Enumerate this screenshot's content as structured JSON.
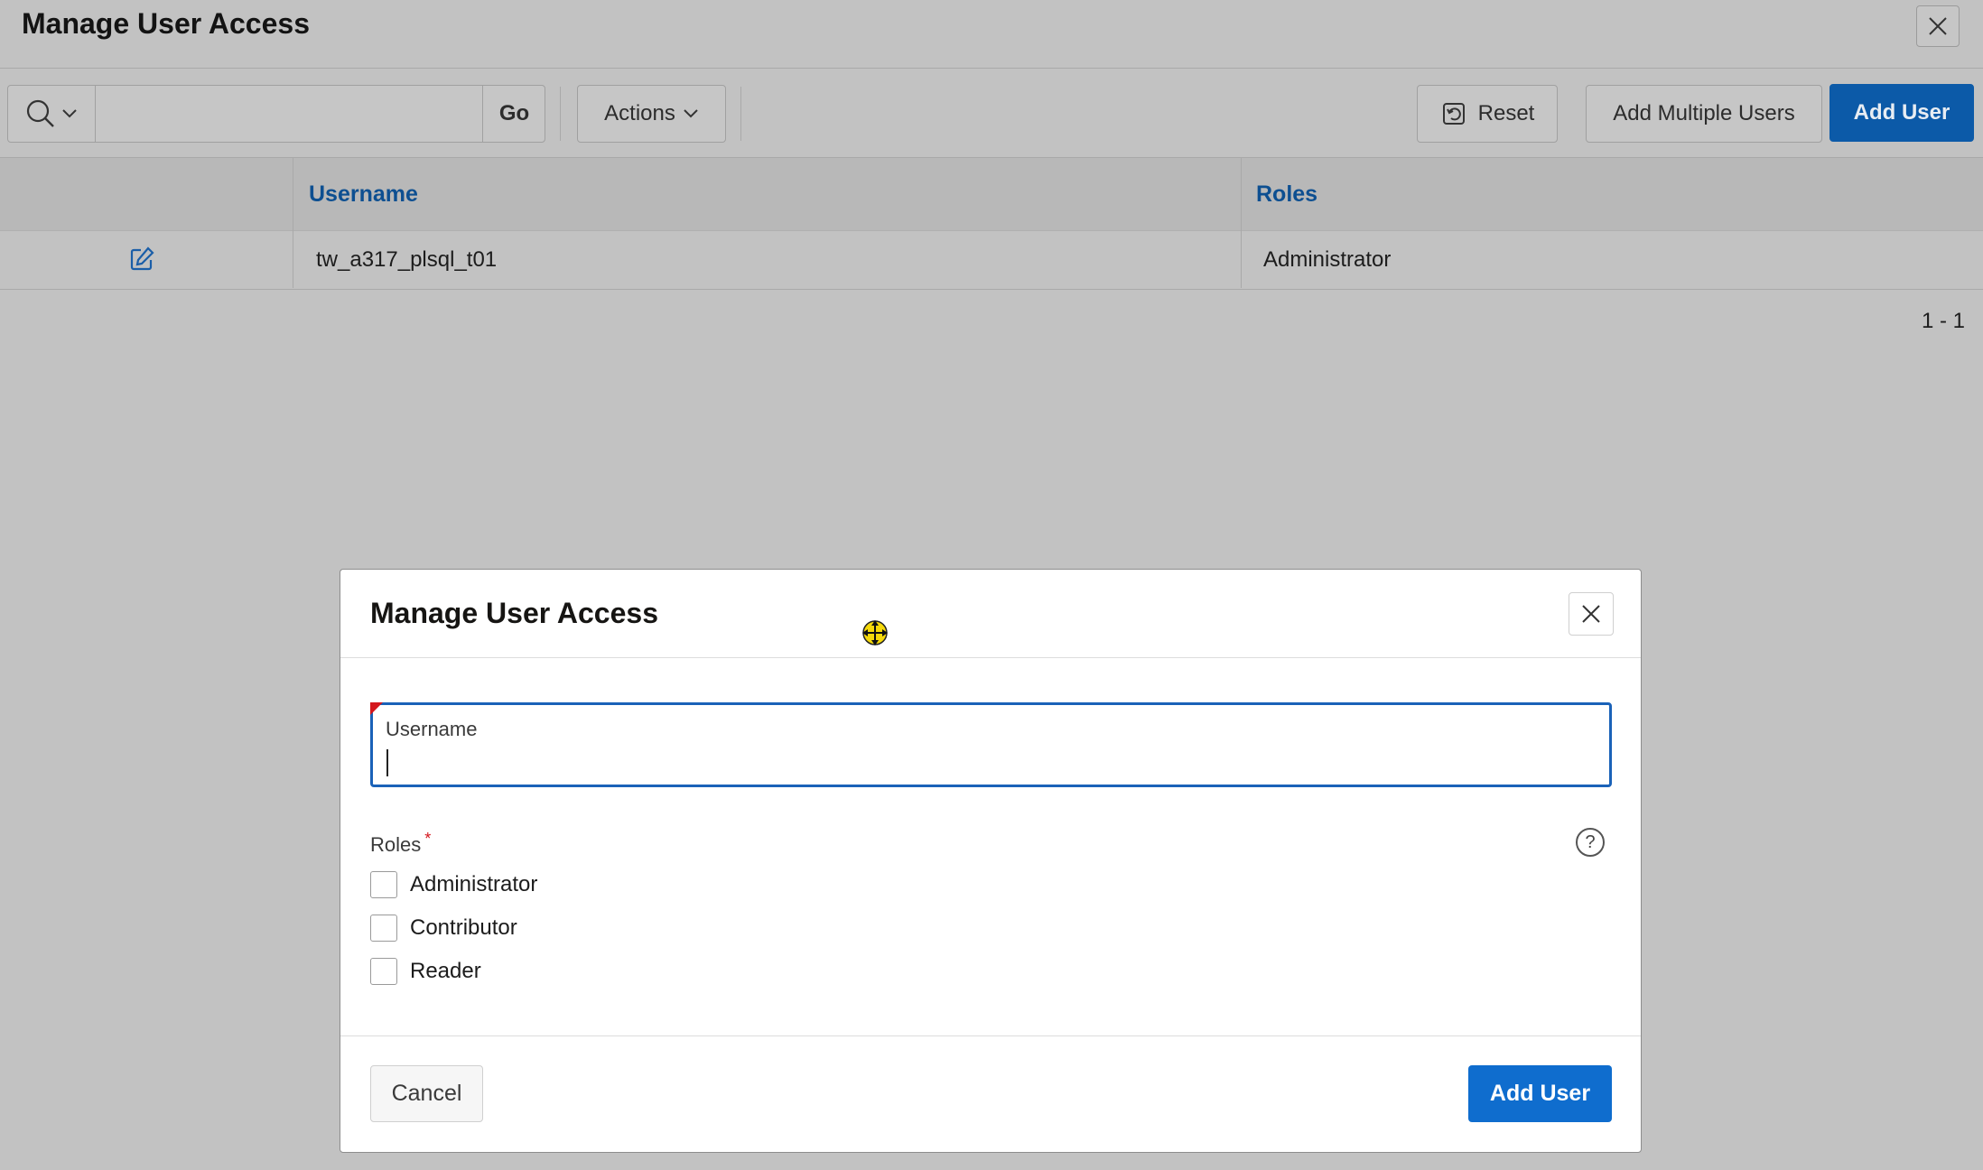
{
  "page": {
    "title": "Manage User Access",
    "close_icon": "close-icon"
  },
  "toolbar": {
    "search_placeholder": "",
    "go_label": "Go",
    "actions_label": "Actions",
    "reset_label": "Reset",
    "add_multiple_label": "Add Multiple Users",
    "add_user_label": "Add User"
  },
  "grid": {
    "columns": [
      "",
      "Username",
      "Roles"
    ],
    "rows": [
      {
        "username": "tw_a317_plsql_t01",
        "roles": "Administrator"
      }
    ],
    "pagination": "1 - 1"
  },
  "dialog": {
    "title": "Manage User Access",
    "username_label": "Username",
    "username_value": "",
    "roles_label": "Roles",
    "required_mark": "*",
    "help_label": "?",
    "role_options": [
      {
        "label": "Administrator",
        "checked": false
      },
      {
        "label": "Contributor",
        "checked": false
      },
      {
        "label": "Reader",
        "checked": false
      }
    ],
    "cancel_label": "Cancel",
    "submit_label": "Add User"
  },
  "colors": {
    "primary": "#0c5aa8",
    "primary_dialog": "#0f6dce",
    "link": "#0d4f91",
    "required": "#d4161c",
    "overlay": "#c2c2c2"
  }
}
